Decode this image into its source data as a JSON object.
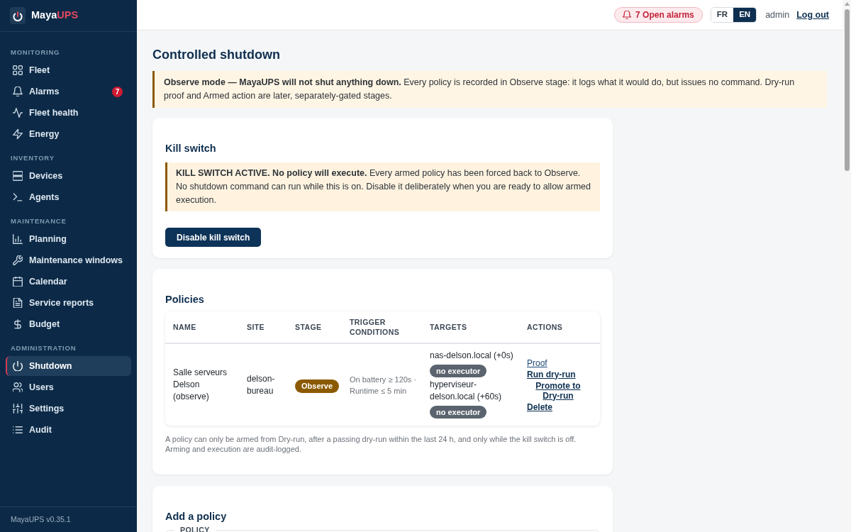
{
  "sidebar": {
    "brand": {
      "name": "Maya",
      "accent": "UPS"
    },
    "sections": [
      {
        "heading": "MONITORING",
        "items": [
          {
            "label": "Fleet",
            "selected": false
          },
          {
            "label": "Alarms",
            "badge": "7",
            "selected": false
          },
          {
            "label": "Fleet health",
            "selected": false
          },
          {
            "label": "Energy",
            "selected": false
          }
        ]
      },
      {
        "heading": "INVENTORY",
        "items": [
          {
            "label": "Devices",
            "selected": false
          },
          {
            "label": "Agents",
            "selected": false
          }
        ]
      },
      {
        "heading": "MAINTENANCE",
        "items": [
          {
            "label": "Planning",
            "selected": false
          },
          {
            "label": "Maintenance windows",
            "selected": false
          },
          {
            "label": "Calendar",
            "selected": false
          },
          {
            "label": "Service reports",
            "selected": false
          },
          {
            "label": "Budget",
            "selected": false
          }
        ]
      },
      {
        "heading": "ADMINISTRATION",
        "items": [
          {
            "label": "Shutdown",
            "selected": true
          },
          {
            "label": "Users",
            "selected": false
          },
          {
            "label": "Settings",
            "selected": false
          },
          {
            "label": "Audit",
            "selected": false
          }
        ]
      }
    ],
    "version": "MayaUPS v0.35.1"
  },
  "topbar": {
    "alarms": "7 Open alarms",
    "languages": [
      {
        "label": "FR",
        "selected": false
      },
      {
        "label": "EN",
        "selected": true
      }
    ],
    "user": "admin",
    "logout": "Log out"
  },
  "title": "Controlled shutdown",
  "observe_banner": "**Observe mode — MayaUPS will not shut anything down.** Every policy is recorded in Observe stage: it logs what it would do, but issues no command. Dry-run proof and Armed action are later, separately-gated stages.",
  "kill_switch": {
    "heading": "Kill switch",
    "alert": "**KILL SWITCH ACTIVE. No policy will execute.** Every armed policy has been forced back to Observe. No shutdown command can run while this is on. Disable it deliberately when you are ready to allow armed execution.",
    "button": "Disable kill switch"
  },
  "policies": {
    "heading": "Policies",
    "table": {
      "columns": [
        "NAME",
        "SITE",
        "STAGE",
        "TRIGGER CONDITIONS",
        "TARGETS",
        "ACTIONS"
      ],
      "rows": [
        {
          "name": "Salle serveurs Delson (observe)",
          "site": "delson-bureau",
          "stage": "Observe",
          "trigger": "On battery ≥ 120s · Runtime ≤ 5 min",
          "targets": [
            {
              "host": "nas-delson.local (+0s)",
              "status": "no executor"
            },
            {
              "host": "hyperviseur-delson.local (+60s)",
              "status": "no executor"
            }
          ],
          "actions": [
            {
              "label": "Proof",
              "kind": "link"
            },
            {
              "label": "Run dry-run",
              "kind": "button"
            },
            {
              "label": "Promote to Dry-run",
              "kind": "button"
            },
            {
              "label": "Delete",
              "kind": "button"
            }
          ]
        }
      ]
    },
    "note": "A policy can only be armed from Dry-run, after a passing dry-run within the last 24 h, and only while the kill switch is off. Arming and execution are audit-logged."
  },
  "add_policy": {
    "heading": "Add a policy",
    "legend": "POLICY"
  }
}
